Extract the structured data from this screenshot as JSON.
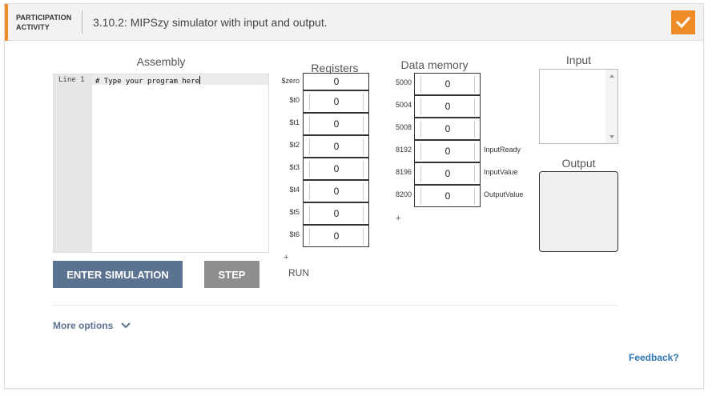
{
  "header": {
    "activity_label_line1": "PARTICIPATION",
    "activity_label_line2": "ACTIVITY",
    "title": "3.10.2: MIPSzy simulator with input and output.",
    "accent_color": "#f08c28",
    "status_icon": "check-icon"
  },
  "assembly": {
    "title": "Assembly",
    "line_label": "Line 1",
    "code": "# Type your program here"
  },
  "buttons": {
    "enter_simulation": "ENTER SIMULATION",
    "step": "STEP",
    "run": "RUN"
  },
  "registers": {
    "title": "Registers",
    "items": [
      {
        "name": "$zero",
        "value": "0"
      },
      {
        "name": "$t0",
        "value": "0"
      },
      {
        "name": "$t1",
        "value": "0"
      },
      {
        "name": "$t2",
        "value": "0"
      },
      {
        "name": "$t3",
        "value": "0"
      },
      {
        "name": "$t4",
        "value": "0"
      },
      {
        "name": "$t5",
        "value": "0"
      },
      {
        "name": "$t6",
        "value": "0"
      }
    ],
    "add": "+"
  },
  "memory": {
    "title": "Data memory",
    "items": [
      {
        "address": "5000",
        "value": "0",
        "note": ""
      },
      {
        "address": "5004",
        "value": "0",
        "note": ""
      },
      {
        "address": "5008",
        "value": "0",
        "note": ""
      },
      {
        "address": "8192",
        "value": "0",
        "note": "InputReady"
      },
      {
        "address": "8196",
        "value": "0",
        "note": "InputValue"
      },
      {
        "address": "8200",
        "value": "0",
        "note": "OutputValue"
      }
    ],
    "add": "+"
  },
  "io": {
    "input_title": "Input",
    "input_value": "",
    "output_title": "Output"
  },
  "footer": {
    "more_options": "More options",
    "feedback": "Feedback?"
  }
}
